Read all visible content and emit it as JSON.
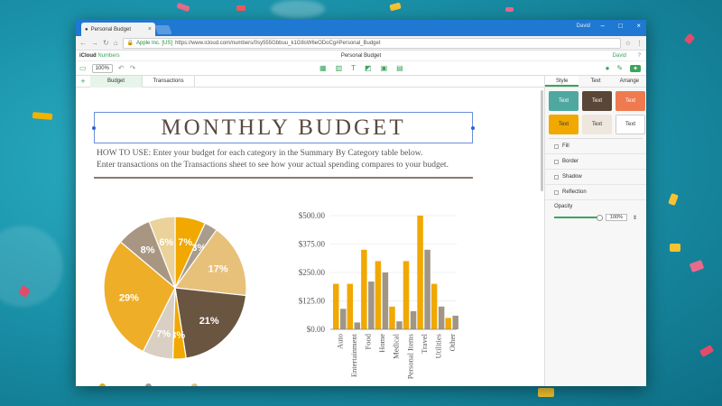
{
  "browser": {
    "tab_title": "Personal Budget",
    "user": "David",
    "secure_label": "Apple Inc. [US]",
    "url": "https://www.icloud.com/numbers/0sy555Gbbuu_k1G8sW6eODoCg#Personal_Budget"
  },
  "app": {
    "brand_bold": "iCloud",
    "brand_name": "Numbers",
    "doc_title": "Personal Budget",
    "user": "David",
    "zoom": "100%"
  },
  "sheets": [
    {
      "label": "Budget"
    },
    {
      "label": "Transactions"
    }
  ],
  "document": {
    "title": "MONTHLY BUDGET",
    "howto_line1": "HOW TO USE: Enter your budget for each category in the Summary By Category table below.",
    "howto_line2": "Enter transactions on the Transactions sheet to see how your actual spending compares to your budget."
  },
  "inspector": {
    "tabs": [
      "Style",
      "Text",
      "Arrange"
    ],
    "swatches": [
      {
        "label": "Text",
        "bg": "#4fa89f",
        "fg": "#ffffff"
      },
      {
        "label": "Text",
        "bg": "#5a4636",
        "fg": "#ffffff"
      },
      {
        "label": "Text",
        "bg": "#ef7a50",
        "fg": "#ffffff"
      },
      {
        "label": "Text",
        "bg": "#f1a800",
        "fg": "#333333"
      },
      {
        "label": "Text",
        "bg": "#efe7dd",
        "fg": "#333333"
      },
      {
        "label": "Text",
        "bg": "#ffffff",
        "fg": "#333333"
      }
    ],
    "fill": "Fill",
    "border": "Border",
    "shadow": "Shadow",
    "reflection": "Reflection",
    "opacity_label": "Opacity",
    "opacity_value": "100%"
  },
  "chart_data": [
    {
      "type": "pie",
      "slices": [
        {
          "label": "7%",
          "value": 7,
          "color": "#f1a800"
        },
        {
          "label": "3%",
          "value": 3,
          "color": "#a89c8d"
        },
        {
          "label": "17%",
          "value": 17,
          "color": "#e7c17a"
        },
        {
          "label": "21%",
          "value": 21,
          "color": "#6a5541"
        },
        {
          "label": "3%",
          "value": 3,
          "color": "#f1a800"
        },
        {
          "label": "7%",
          "value": 7,
          "color": "#d9cfc3"
        },
        {
          "label": "29%",
          "value": 29,
          "color": "#eeae28"
        },
        {
          "label": "8%",
          "value": 8,
          "color": "#a89683"
        },
        {
          "label": "6%",
          "value": 6,
          "color": "#ead29a"
        }
      ]
    },
    {
      "type": "bar",
      "categories": [
        "Auto",
        "Entertainment",
        "Food",
        "Home",
        "Medical",
        "Personal Items",
        "Travel",
        "Utilities",
        "Other"
      ],
      "series": [
        {
          "values": [
            200,
            200,
            350,
            300,
            100,
            300,
            500,
            200,
            50
          ],
          "color": "#f1a800"
        },
        {
          "values": [
            90,
            30,
            210,
            250,
            35,
            80,
            350,
            100,
            60
          ],
          "color": "#a19584"
        }
      ],
      "yticks": [
        "$0.00",
        "$125.00",
        "$250.00",
        "$375.00",
        "$500.00"
      ],
      "ylim": [
        0,
        500
      ]
    }
  ]
}
